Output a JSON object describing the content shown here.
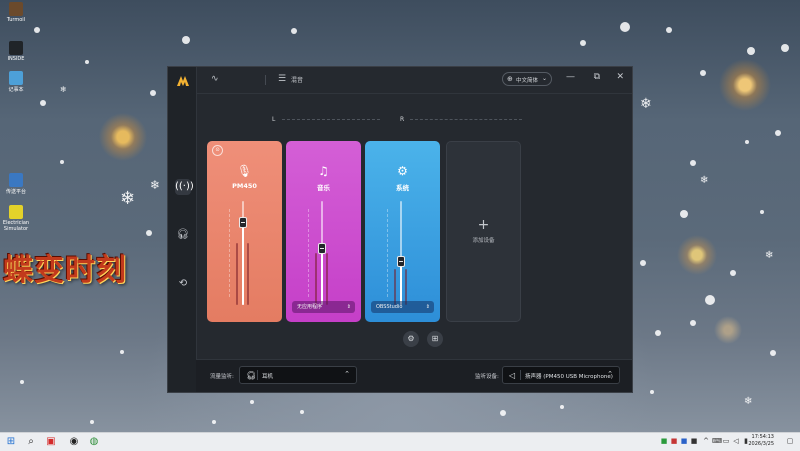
{
  "desktop": {
    "icons": [
      {
        "label": "Turmoil",
        "icon": "game-icon",
        "color": "#6b4a2c"
      },
      {
        "label": "INSIDE",
        "icon": "game-icon",
        "color": "#202428"
      },
      {
        "label": "记事本",
        "icon": "notepad-icon",
        "color": "#4da0d8"
      },
      {
        "label": "传送平台",
        "icon": "app-icon",
        "color": "#3a78c2"
      },
      {
        "label": "Electrician Simulator",
        "icon": "game-icon",
        "color": "#e4d22a"
      }
    ],
    "banner_text": "蝶变时刻"
  },
  "app": {
    "topbar": {
      "menu_label": "混音",
      "language_label": "中文简体"
    },
    "sidebar": [
      {
        "icon": "broadcast-icon",
        "active": true
      },
      {
        "icon": "headphones-icon",
        "active": false
      },
      {
        "icon": "sync-icon",
        "active": false
      }
    ],
    "channels_header": {
      "left": "L",
      "right": "R"
    },
    "channels": [
      {
        "name": "PM450",
        "icon": "microphone-icon",
        "color_top": "#ef8f79",
        "color_bottom": "#e47c62",
        "level": 0.8,
        "meter": 0.6,
        "select": ""
      },
      {
        "name": "音乐",
        "icon": "music-icon",
        "color_top": "#d45fd6",
        "color_bottom": "#c53fc8",
        "level": 0.55,
        "meter": 0.5,
        "select": "无应用程序"
      },
      {
        "name": "系统",
        "icon": "gear-icon",
        "color_top": "#4bb3ea",
        "color_bottom": "#2d8ed8",
        "level": 0.42,
        "meter": 0.35,
        "select": "OBSStudio"
      }
    ],
    "add_device_label": "添加设备",
    "bottom": {
      "monitor_label": "流量监听:",
      "monitor_value": "耳机",
      "output_label": "监听设备:",
      "output_value": "扬声器 (PM450 USB Microphone)"
    }
  },
  "taskbar": {
    "time": "17:54:13",
    "date": "2026/3/25"
  }
}
